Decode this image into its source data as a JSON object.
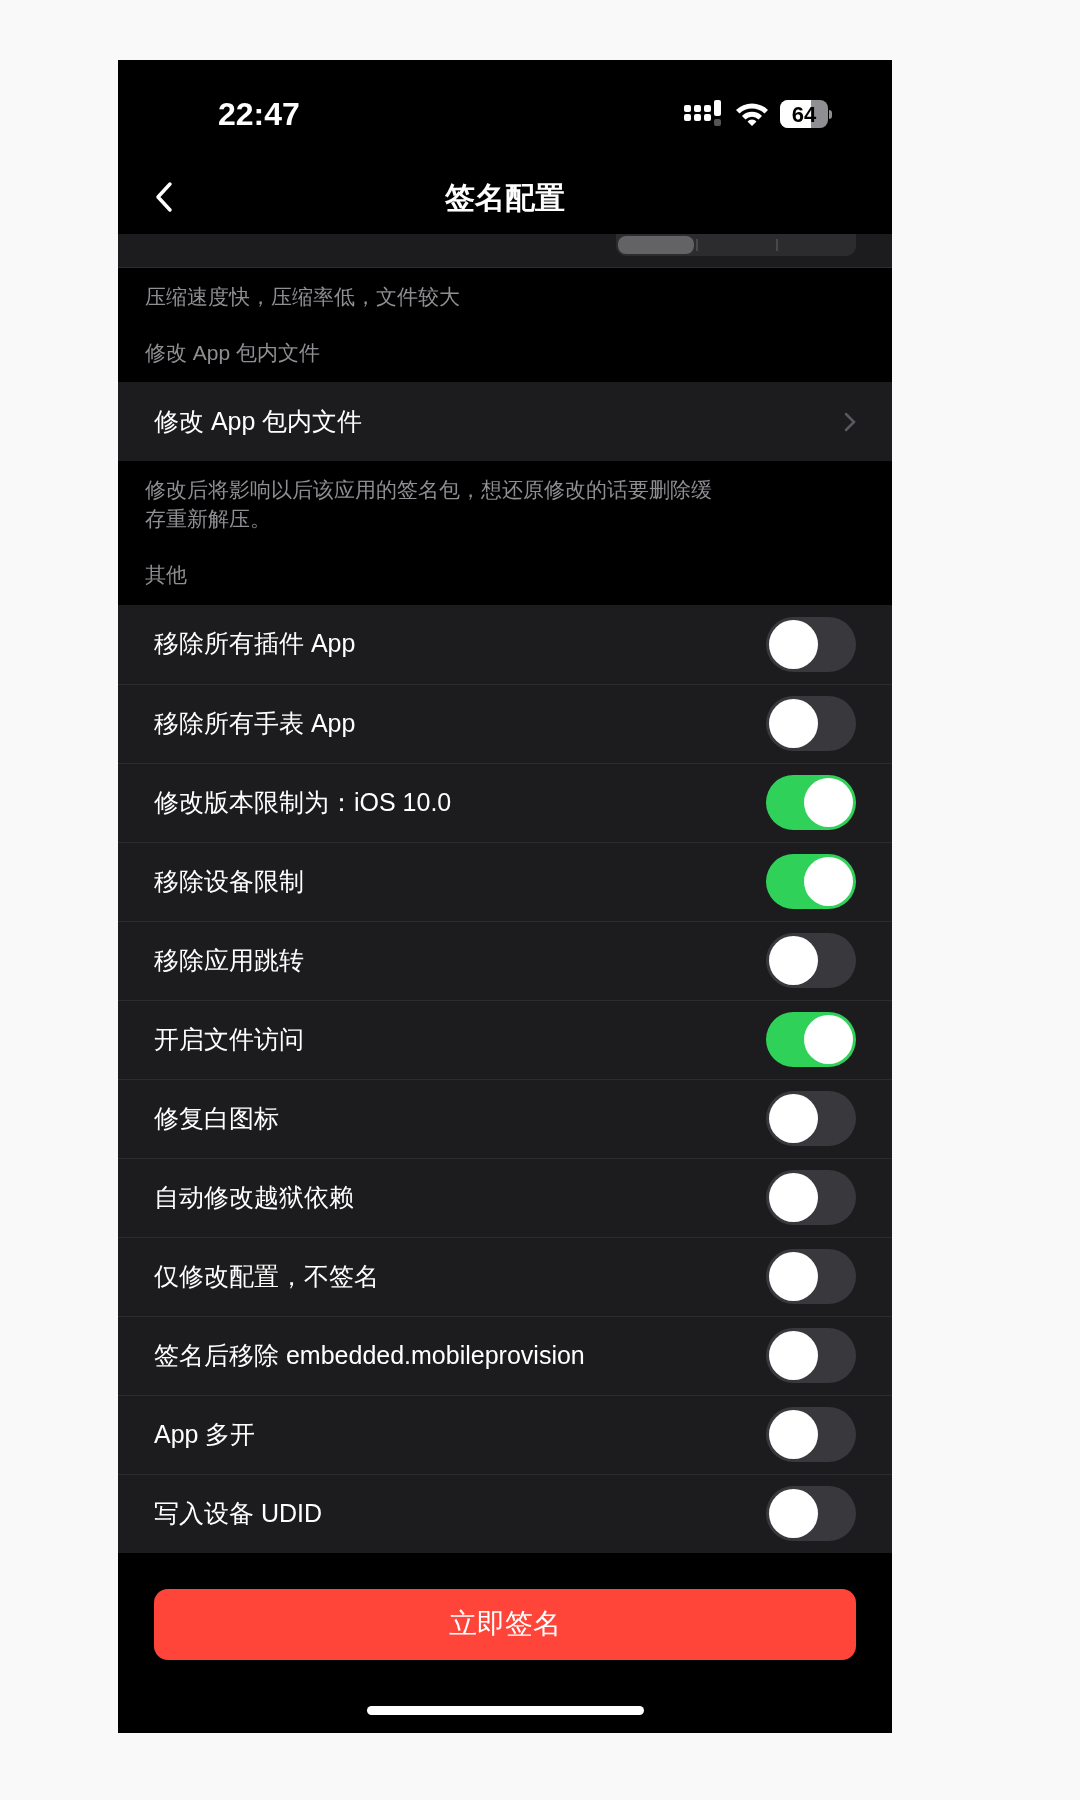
{
  "status_bar": {
    "time": "22:47",
    "battery": "64"
  },
  "nav": {
    "title": "签名配置"
  },
  "compression": {
    "footer": "压缩速度快，压缩率低，文件较大",
    "segments": [
      {
        "selected": true
      },
      {
        "selected": false
      },
      {
        "selected": false
      }
    ]
  },
  "modify_section": {
    "header": "修改 App 包内文件",
    "row": "修改 App 包内文件",
    "footer": "修改后将影响以后该应用的签名包，想还原修改的话要删除缓存重新解压。"
  },
  "other_section": {
    "header": "其他",
    "toggles": [
      {
        "label": "移除所有插件 App",
        "on": false
      },
      {
        "label": "移除所有手表 App",
        "on": false
      },
      {
        "label": "修改版本限制为：iOS 10.0",
        "on": true
      },
      {
        "label": "移除设备限制",
        "on": true
      },
      {
        "label": "移除应用跳转",
        "on": false
      },
      {
        "label": "开启文件访问",
        "on": true
      },
      {
        "label": "修复白图标",
        "on": false
      },
      {
        "label": "自动修改越狱依赖",
        "on": false
      },
      {
        "label": "仅修改配置，不签名",
        "on": false
      },
      {
        "label": "签名后移除 embedded.mobileprovision",
        "on": false
      },
      {
        "label": "App 多开",
        "on": false
      },
      {
        "label": "写入设备 UDID",
        "on": false
      }
    ]
  },
  "sign_button": "立即签名"
}
